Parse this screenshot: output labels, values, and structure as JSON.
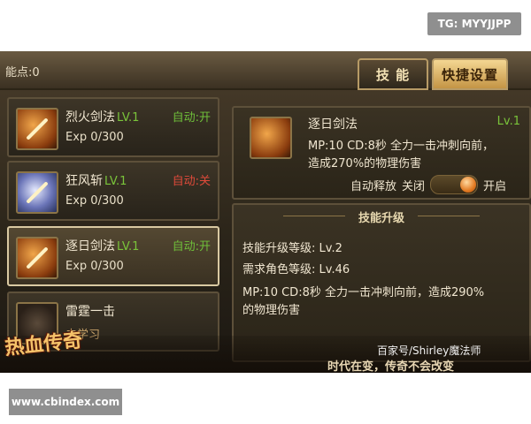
{
  "watermarks": {
    "top": "TG: MYYJJPP",
    "bottom": "www.cbindex.com"
  },
  "header": {
    "points_label": "能点:0"
  },
  "tabs": [
    {
      "label": "技 能"
    },
    {
      "label": "快捷设置"
    }
  ],
  "skills": [
    {
      "name": "烈火剑法",
      "level": "LV.1",
      "auto": "自动:开",
      "exp": "Exp 0/300",
      "icon": "fire-sword-icon"
    },
    {
      "name": "狂风斩",
      "level": "LV.1",
      "auto": "自动:关",
      "exp": "Exp 0/300",
      "icon": "wind-slash-icon"
    },
    {
      "name": "逐日剑法",
      "level": "LV.1",
      "auto": "自动:开",
      "exp": "Exp 0/300",
      "icon": "sun-sword-icon"
    },
    {
      "name": "雷霆一击",
      "level": "",
      "auto": "",
      "exp": "未学习",
      "icon": "thunder-strike-icon"
    }
  ],
  "detail": {
    "name": "逐日剑法",
    "level": "Lv.1",
    "desc_line1": "MP:10  CD:8秒  全力一击冲刺向前，",
    "desc_line2": "造成270%的物理伤害",
    "auto_label": "自动释放",
    "off_label": "关闭",
    "on_label": "开启",
    "auto_state": "on"
  },
  "upgrade": {
    "title": "技能升级",
    "upgrade_level": "技能升级等级: Lv.2",
    "required_level": "需求角色等级: Lv.46",
    "desc_line1": "MP:10  CD:8秒  全力一击冲刺向前，造成290%",
    "desc_line2": "的物理伤害"
  },
  "banner": {
    "logo": "热血传奇",
    "source": "百家号/Shirley魔法师",
    "slogan": "时代在变，传奇不会改变"
  }
}
